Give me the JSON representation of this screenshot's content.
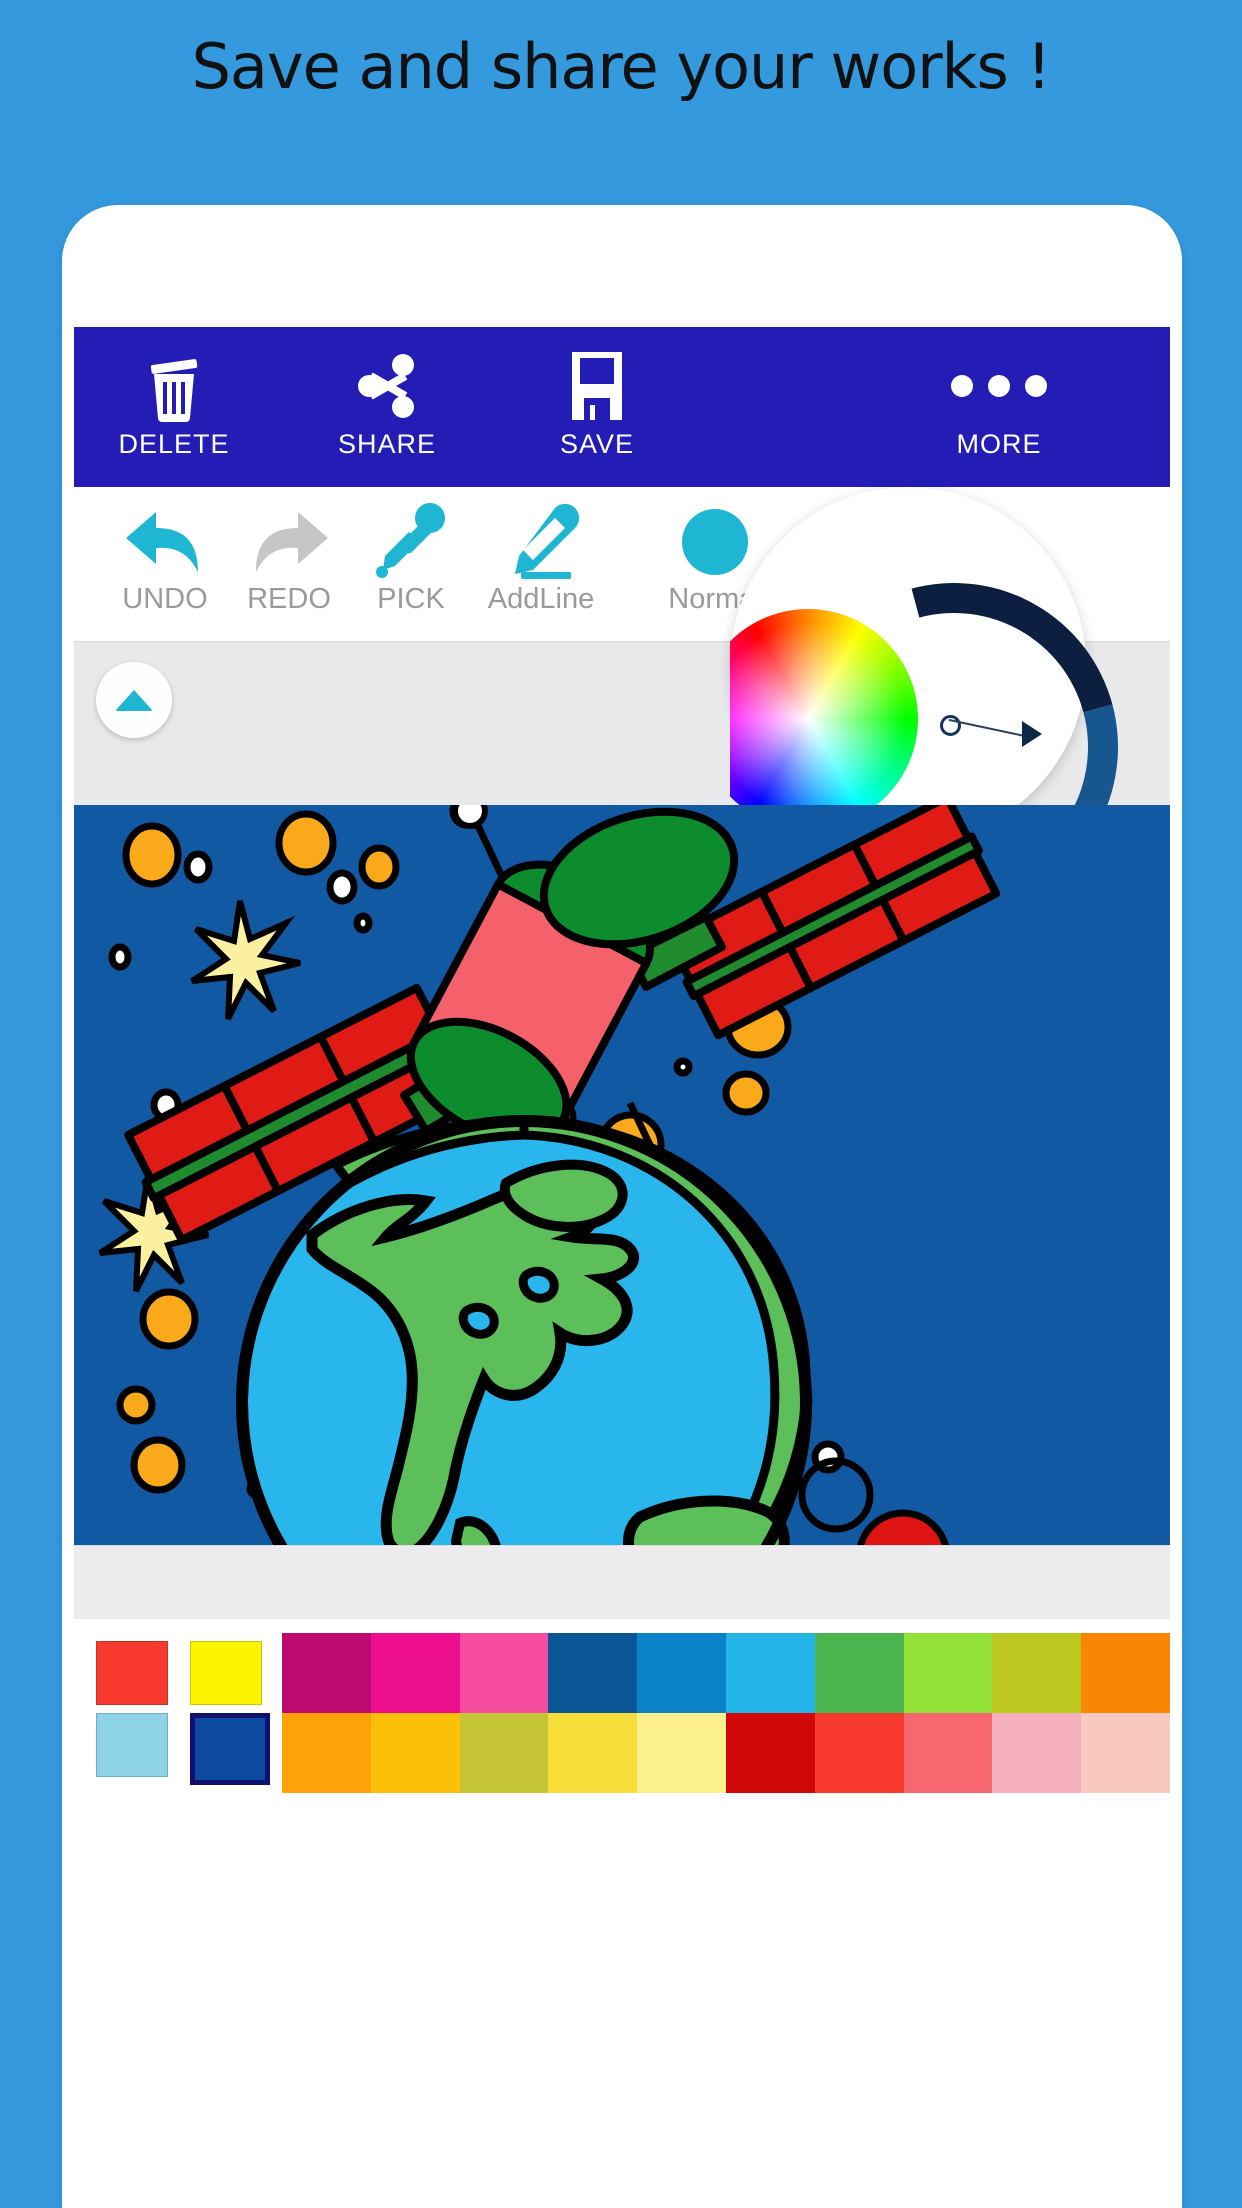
{
  "headline": "Save and share your works !",
  "theme": {
    "page_bg": "#3499dd",
    "actionbar_bg": "#231db5",
    "accent": "#1fb6d4",
    "canvas_bg": "#1259a4",
    "disabled": "#bdbdbd"
  },
  "actionbar": {
    "items": [
      {
        "id": "act-delete",
        "icon": "trash-icon",
        "label": "DELETE"
      },
      {
        "id": "act-share",
        "icon": "share-icon",
        "label": "SHARE"
      },
      {
        "id": "act-save",
        "icon": "floppy-disk-icon",
        "label": "SAVE"
      },
      {
        "id": "act-more",
        "icon": "more-dots-icon",
        "label": "MORE"
      }
    ]
  },
  "toolrow": {
    "items": [
      {
        "id": "tool-undo",
        "icon": "undo-arrow-icon",
        "label": "UNDO",
        "enabled": true
      },
      {
        "id": "tool-redo",
        "icon": "redo-arrow-icon",
        "label": "REDO",
        "enabled": false
      },
      {
        "id": "tool-pick",
        "icon": "eyedropper-icon",
        "label": "PICK",
        "enabled": true
      },
      {
        "id": "tool-addline",
        "icon": "pencil-icon",
        "label": "AddLine",
        "enabled": true
      },
      {
        "id": "tool-normal",
        "icon": "filled-circle-icon",
        "label": "Normal",
        "enabled": true
      }
    ]
  },
  "expand_panel": {
    "button_icon": "caret-up-icon"
  },
  "color_picker": {
    "type": "hsv-wheel",
    "ring_colors": [
      "#0c1f40",
      "#17568f",
      "#1078c8"
    ],
    "selected_color": "#10349b",
    "marker_icon": "wheel-marker-icon",
    "pointer_icon": "ring-pointer-icon"
  },
  "canvas": {
    "title": "satellite-over-earth-coloring",
    "background": "#1259a4",
    "palette_used": {
      "space": "#1259a4",
      "earth_ocean": "#29b6ec",
      "earth_land": "#5cbf5a",
      "satellite_body": "#f4616a",
      "satellite_caps": "#0d8c2e",
      "solar_panels": "#e01b16",
      "panel_spine": "#1f8a2e",
      "star": "#fbf0a0",
      "orb_orange": "#f9a919",
      "orb_white": "#ffffff",
      "orb_red": "#e01313",
      "outline": "#000000"
    }
  },
  "palette": {
    "current_swatches": [
      {
        "color": "#f93a31",
        "selected": false
      },
      {
        "color": "#fcf300",
        "selected": false
      },
      {
        "color": "#8fd3e8",
        "selected": false
      },
      {
        "color": "#0b4a9e",
        "selected": true
      }
    ],
    "rows": [
      [
        "#bd0a6e",
        "#ec0e8c",
        "#f54ca0",
        "#0a5595",
        "#0b82c7",
        "#23b4e8",
        "#4cb550",
        "#93e038",
        "#bcc71f",
        "#f98604"
      ],
      [
        "#fda309",
        "#fdc008",
        "#c4c434",
        "#f7de3a",
        "#fbf08a",
        "#d00808",
        "#f93a31",
        "#f7676f",
        "#f5aebb",
        "#f9c9c0"
      ]
    ]
  }
}
